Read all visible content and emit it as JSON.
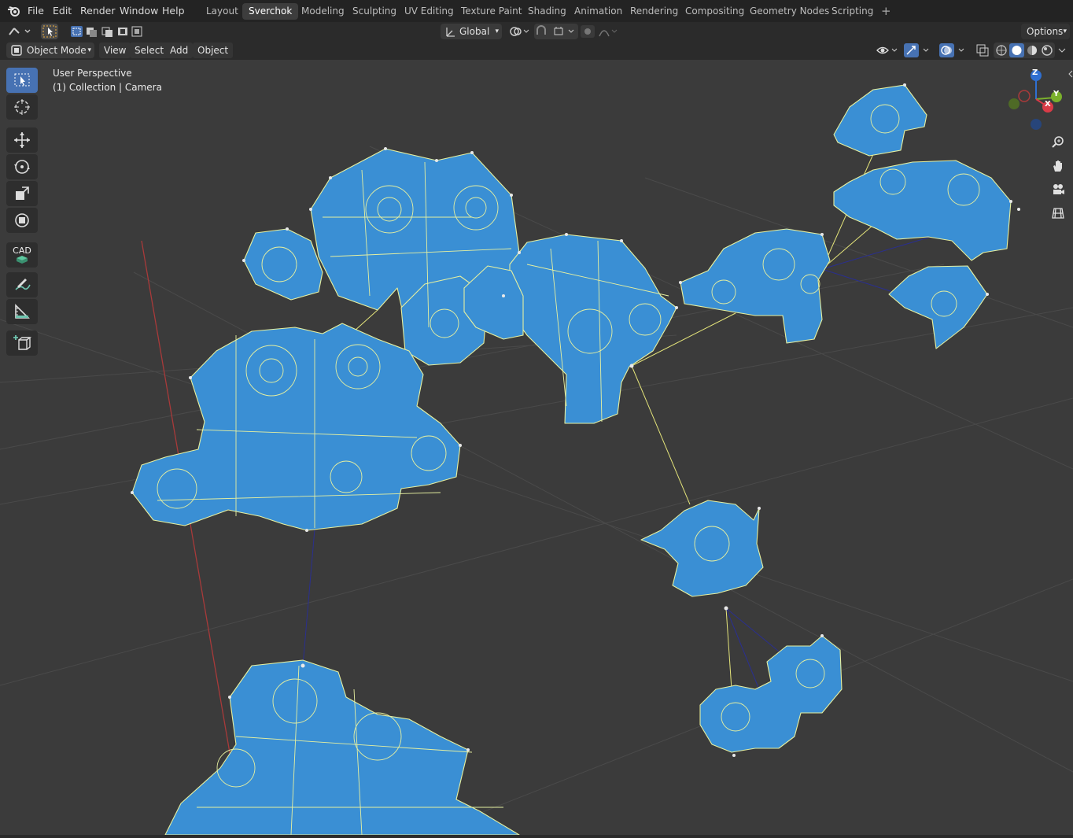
{
  "menu": {
    "blender_icon": "blender-logo-icon",
    "items": [
      "File",
      "Edit",
      "Render",
      "Window",
      "Help"
    ]
  },
  "workspaces": {
    "tabs": [
      "Layout",
      "Sverchok",
      "Modeling",
      "Sculpting",
      "UV Editing",
      "Texture Paint",
      "Shading",
      "Animation",
      "Rendering",
      "Compositing",
      "Geometry Nodes",
      "Scripting"
    ],
    "active": "Sverchok",
    "add_icon": "plus-icon"
  },
  "tool_header": {
    "transform_orientation": "Global",
    "options_label": "Options"
  },
  "view_header": {
    "mode": "Object Mode",
    "menus": [
      "View",
      "Select",
      "Add",
      "Object"
    ]
  },
  "viewport": {
    "perspective_label": "User Perspective",
    "collection_label": "(1) Collection | Camera",
    "axes": {
      "x": "X",
      "y": "Y",
      "z": "Z"
    },
    "cad_label": "CAD"
  },
  "colors": {
    "mesh_fill": "#3a8fd4",
    "mesh_edge": "#e6f0a0",
    "vertex": "#e8e8e8",
    "grid_line": "#4a4a4a",
    "axis_x": "#ab3838",
    "link_yellow": "#e4e47a",
    "link_blue": "#2a2f8f",
    "active_blue": "#4772b3",
    "header_bg": "#2b2b2b",
    "viewport_bg": "#3b3b3b"
  }
}
